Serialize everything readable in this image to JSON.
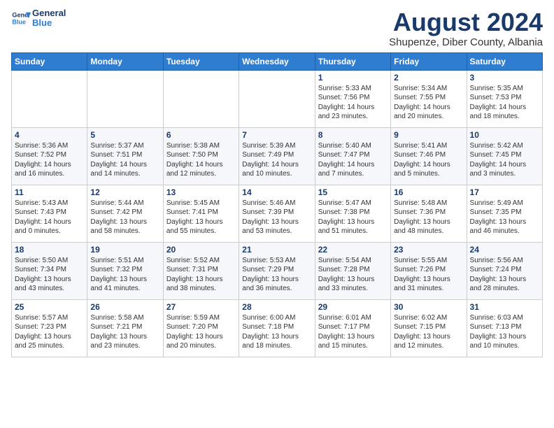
{
  "header": {
    "logo_general": "General",
    "logo_blue": "Blue",
    "month_year": "August 2024",
    "location": "Shupenze, Diber County, Albania"
  },
  "weekdays": [
    "Sunday",
    "Monday",
    "Tuesday",
    "Wednesday",
    "Thursday",
    "Friday",
    "Saturday"
  ],
  "weeks": [
    [
      {
        "day": "",
        "info": ""
      },
      {
        "day": "",
        "info": ""
      },
      {
        "day": "",
        "info": ""
      },
      {
        "day": "",
        "info": ""
      },
      {
        "day": "1",
        "info": "Sunrise: 5:33 AM\nSunset: 7:56 PM\nDaylight: 14 hours\nand 23 minutes."
      },
      {
        "day": "2",
        "info": "Sunrise: 5:34 AM\nSunset: 7:55 PM\nDaylight: 14 hours\nand 20 minutes."
      },
      {
        "day": "3",
        "info": "Sunrise: 5:35 AM\nSunset: 7:53 PM\nDaylight: 14 hours\nand 18 minutes."
      }
    ],
    [
      {
        "day": "4",
        "info": "Sunrise: 5:36 AM\nSunset: 7:52 PM\nDaylight: 14 hours\nand 16 minutes."
      },
      {
        "day": "5",
        "info": "Sunrise: 5:37 AM\nSunset: 7:51 PM\nDaylight: 14 hours\nand 14 minutes."
      },
      {
        "day": "6",
        "info": "Sunrise: 5:38 AM\nSunset: 7:50 PM\nDaylight: 14 hours\nand 12 minutes."
      },
      {
        "day": "7",
        "info": "Sunrise: 5:39 AM\nSunset: 7:49 PM\nDaylight: 14 hours\nand 10 minutes."
      },
      {
        "day": "8",
        "info": "Sunrise: 5:40 AM\nSunset: 7:47 PM\nDaylight: 14 hours\nand 7 minutes."
      },
      {
        "day": "9",
        "info": "Sunrise: 5:41 AM\nSunset: 7:46 PM\nDaylight: 14 hours\nand 5 minutes."
      },
      {
        "day": "10",
        "info": "Sunrise: 5:42 AM\nSunset: 7:45 PM\nDaylight: 14 hours\nand 3 minutes."
      }
    ],
    [
      {
        "day": "11",
        "info": "Sunrise: 5:43 AM\nSunset: 7:43 PM\nDaylight: 14 hours\nand 0 minutes."
      },
      {
        "day": "12",
        "info": "Sunrise: 5:44 AM\nSunset: 7:42 PM\nDaylight: 13 hours\nand 58 minutes."
      },
      {
        "day": "13",
        "info": "Sunrise: 5:45 AM\nSunset: 7:41 PM\nDaylight: 13 hours\nand 55 minutes."
      },
      {
        "day": "14",
        "info": "Sunrise: 5:46 AM\nSunset: 7:39 PM\nDaylight: 13 hours\nand 53 minutes."
      },
      {
        "day": "15",
        "info": "Sunrise: 5:47 AM\nSunset: 7:38 PM\nDaylight: 13 hours\nand 51 minutes."
      },
      {
        "day": "16",
        "info": "Sunrise: 5:48 AM\nSunset: 7:36 PM\nDaylight: 13 hours\nand 48 minutes."
      },
      {
        "day": "17",
        "info": "Sunrise: 5:49 AM\nSunset: 7:35 PM\nDaylight: 13 hours\nand 46 minutes."
      }
    ],
    [
      {
        "day": "18",
        "info": "Sunrise: 5:50 AM\nSunset: 7:34 PM\nDaylight: 13 hours\nand 43 minutes."
      },
      {
        "day": "19",
        "info": "Sunrise: 5:51 AM\nSunset: 7:32 PM\nDaylight: 13 hours\nand 41 minutes."
      },
      {
        "day": "20",
        "info": "Sunrise: 5:52 AM\nSunset: 7:31 PM\nDaylight: 13 hours\nand 38 minutes."
      },
      {
        "day": "21",
        "info": "Sunrise: 5:53 AM\nSunset: 7:29 PM\nDaylight: 13 hours\nand 36 minutes."
      },
      {
        "day": "22",
        "info": "Sunrise: 5:54 AM\nSunset: 7:28 PM\nDaylight: 13 hours\nand 33 minutes."
      },
      {
        "day": "23",
        "info": "Sunrise: 5:55 AM\nSunset: 7:26 PM\nDaylight: 13 hours\nand 31 minutes."
      },
      {
        "day": "24",
        "info": "Sunrise: 5:56 AM\nSunset: 7:24 PM\nDaylight: 13 hours\nand 28 minutes."
      }
    ],
    [
      {
        "day": "25",
        "info": "Sunrise: 5:57 AM\nSunset: 7:23 PM\nDaylight: 13 hours\nand 25 minutes."
      },
      {
        "day": "26",
        "info": "Sunrise: 5:58 AM\nSunset: 7:21 PM\nDaylight: 13 hours\nand 23 minutes."
      },
      {
        "day": "27",
        "info": "Sunrise: 5:59 AM\nSunset: 7:20 PM\nDaylight: 13 hours\nand 20 minutes."
      },
      {
        "day": "28",
        "info": "Sunrise: 6:00 AM\nSunset: 7:18 PM\nDaylight: 13 hours\nand 18 minutes."
      },
      {
        "day": "29",
        "info": "Sunrise: 6:01 AM\nSunset: 7:17 PM\nDaylight: 13 hours\nand 15 minutes."
      },
      {
        "day": "30",
        "info": "Sunrise: 6:02 AM\nSunset: 7:15 PM\nDaylight: 13 hours\nand 12 minutes."
      },
      {
        "day": "31",
        "info": "Sunrise: 6:03 AM\nSunset: 7:13 PM\nDaylight: 13 hours\nand 10 minutes."
      }
    ]
  ]
}
